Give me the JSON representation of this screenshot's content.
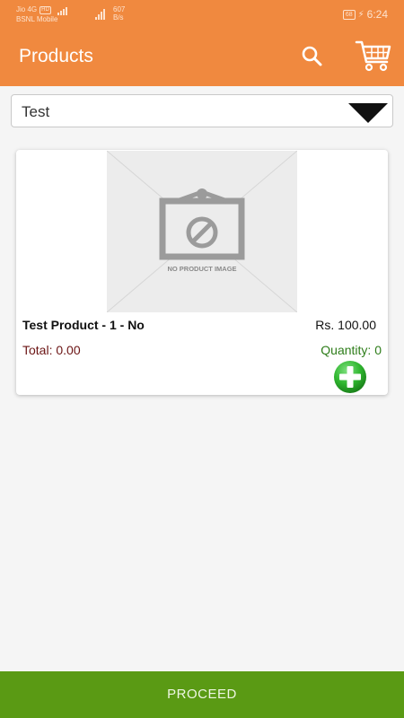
{
  "status_bar": {
    "carrier1": "Jio 4G",
    "volte": "HD",
    "carrier2": "BSNL Mobile",
    "data_speed_value": "607",
    "data_speed_unit": "B/s",
    "battery": "68",
    "time": "6:24"
  },
  "app_bar": {
    "title": "Products",
    "search_icon": "search-icon",
    "cart_icon": "cart-icon"
  },
  "category_dropdown": {
    "selected": "Test",
    "icon": "dropdown-arrow-icon"
  },
  "products": [
    {
      "image_text": "NO PRODUCT IMAGE",
      "name": "Test Product - 1 - No",
      "price": "Rs. 100.00",
      "total": "Total: 0.00",
      "quantity": "Quantity: 0",
      "add_icon": "add-circle-icon"
    }
  ],
  "footer": {
    "proceed_label": "PROCEED"
  },
  "colors": {
    "primary": "#f0893f",
    "proceed": "#5a9a14",
    "total_text": "#6b1414",
    "quantity_text": "#2e7d1a"
  }
}
